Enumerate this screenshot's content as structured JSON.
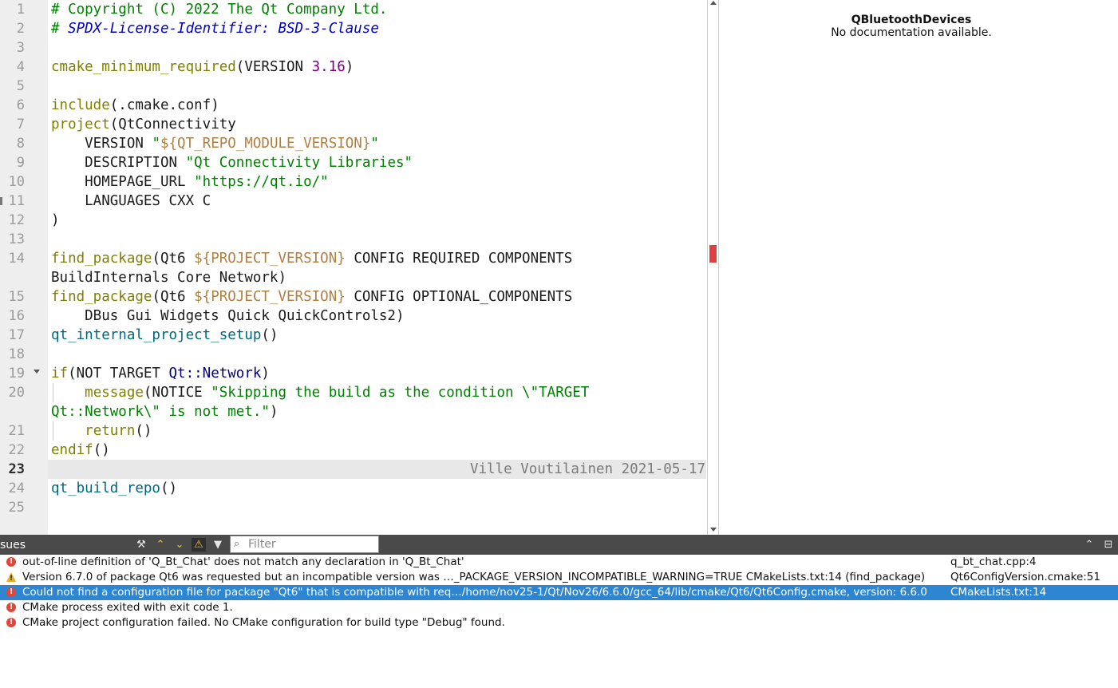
{
  "editor": {
    "lines": [
      {
        "n": "1",
        "html": "<span class='c-com'># Copyright (C) 2022 The Qt Company Ltd.</span>"
      },
      {
        "n": "2",
        "html": "<span class='c-com'># </span><span class='c-spdx'>SPDX-License-Identifier: BSD-3-Clause</span>"
      },
      {
        "n": "3",
        "html": ""
      },
      {
        "n": "4",
        "html": "<span class='c-fn'>cmake_minimum_required</span>(VERSION <span class='c-num'>3.16</span>)"
      },
      {
        "n": "5",
        "html": ""
      },
      {
        "n": "6",
        "html": "<span class='c-fn'>include</span>(.cmake.conf)"
      },
      {
        "n": "7",
        "html": "<span class='c-fn'>project</span>(QtConnectivity"
      },
      {
        "n": "8",
        "html": "    VERSION <span class='c-str'>\"</span><span class='c-var'>${QT_REPO_MODULE_VERSION}</span><span class='c-str'>\"</span>"
      },
      {
        "n": "9",
        "html": "    DESCRIPTION <span class='c-str'>\"Qt Connectivity Libraries\"</span>"
      },
      {
        "n": "10",
        "html": "    HOMEPAGE_URL <span class='c-str'>\"https://qt.io/\"</span>"
      },
      {
        "n": "11",
        "html": "    LANGUAGES CXX C",
        "mark": true
      },
      {
        "n": "12",
        "html": ")"
      },
      {
        "n": "13",
        "html": ""
      },
      {
        "n": "14",
        "html": "<span class='c-fn'>find_package</span>(Qt6 <span class='c-var'>${PROJECT_VERSION}</span> CONFIG REQUIRED COMPONENTS"
      },
      {
        "n": "",
        "html": "BuildInternals Core Network)"
      },
      {
        "n": "15",
        "html": "<span class='c-fn'>find_package</span>(Qt6 <span class='c-var'>${PROJECT_VERSION}</span> CONFIG OPTIONAL_COMPONENTS"
      },
      {
        "n": "16",
        "html": "    DBus Gui Widgets Quick QuickControls2)"
      },
      {
        "n": "17",
        "html": "<span class='c-fn2'>qt_internal_project_setup</span>()"
      },
      {
        "n": "18",
        "html": ""
      },
      {
        "n": "19",
        "html": "<span class='c-fn'>if</span>(NOT TARGET <span class='c-ns'>Qt::Network</span>)",
        "fold": true
      },
      {
        "n": "20",
        "html": "    <span class='c-fn'>message</span>(NOTICE <span class='c-str'>\"Skipping the build as the condition \\\"TARGET</span>",
        "guide": true
      },
      {
        "n": "",
        "html": "<span class='c-str'>Qt::Network\\\" is not met.\"</span>)"
      },
      {
        "n": "21",
        "html": "    <span class='c-fn'>return</span>()",
        "guide": true
      },
      {
        "n": "22",
        "html": "<span class='c-fn'>endif</span>()"
      },
      {
        "n": "23",
        "html": "",
        "current": true,
        "blame": "Ville Voutilainen 2021-05-17"
      },
      {
        "n": "24",
        "html": "<span class='c-fn2'>qt_build_repo</span>()"
      },
      {
        "n": "25",
        "html": ""
      }
    ]
  },
  "help": {
    "title": "QBluetoothDevices",
    "body": "No documentation available."
  },
  "issues": {
    "title": "sues",
    "filter_placeholder": "Filter",
    "items": [
      {
        "type": "error",
        "desc": "out-of-line definition of 'Q_Bt_Chat' does not match any declaration in 'Q_Bt_Chat'",
        "loc": "q_bt_chat.cpp:4"
      },
      {
        "type": "warning",
        "desc": "Version 6.7.0 of package Qt6 was requested but an incompatible version was …_PACKAGE_VERSION_INCOMPATIBLE_WARNING=TRUE CMakeLists.txt:14 (find_package)",
        "loc": "Qt6ConfigVersion.cmake:51"
      },
      {
        "type": "error",
        "desc": "Could not find a configuration file for package \"Qt6\" that is compatible with req…/home/nov25-1/Qt/Nov26/6.6.0/gcc_64/lib/cmake/Qt6/Qt6Config.cmake, version: 6.6.0",
        "loc": "CMakeLists.txt:14",
        "selected": true
      },
      {
        "type": "error",
        "desc": "CMake process exited with exit code 1.",
        "loc": ""
      },
      {
        "type": "error",
        "desc": "CMake project configuration failed. No CMake configuration for build type \"Debug\" found.",
        "loc": ""
      }
    ]
  }
}
